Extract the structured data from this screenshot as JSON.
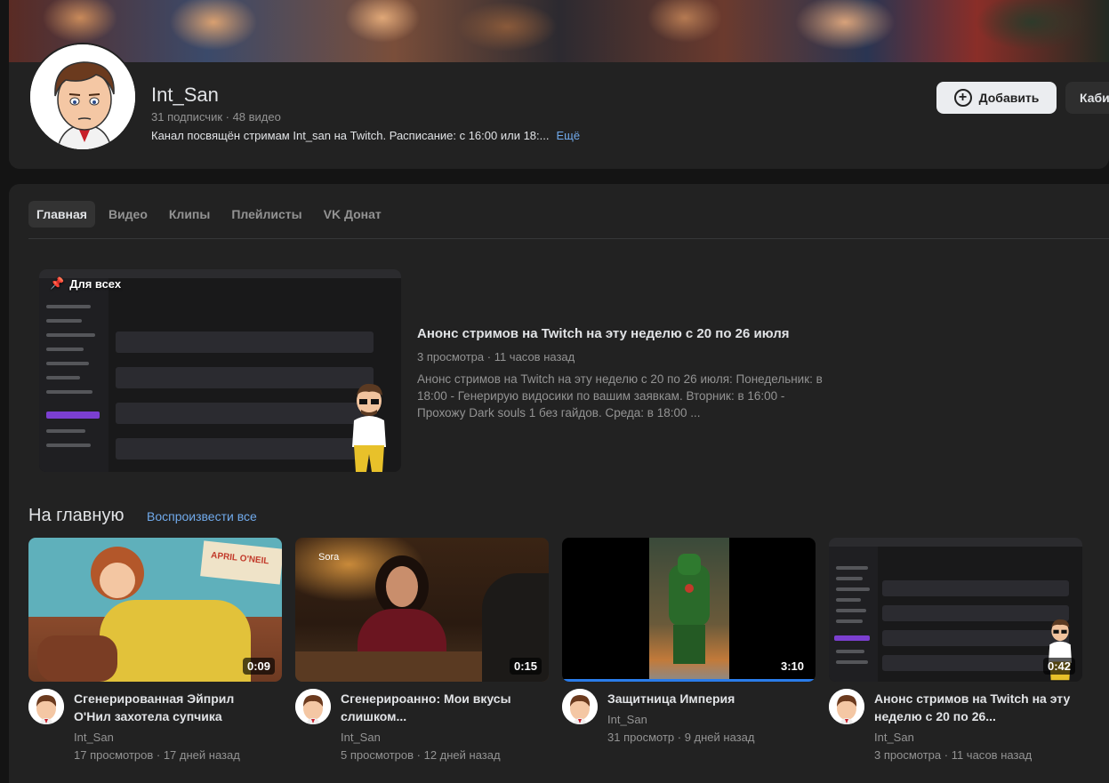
{
  "channel": {
    "name": "Int_San",
    "stats": "31 подписчик · 48 видео",
    "description": "Канал посвящён стримам Int_san на Twitch. Расписание: с 16:00 или 18:...",
    "more": "Ещё",
    "add_label": "Добавить",
    "cabinet_label": "Кабинет"
  },
  "tabs": [
    {
      "label": "Главная",
      "active": true
    },
    {
      "label": "Видео"
    },
    {
      "label": "Клипы"
    },
    {
      "label": "Плейлисты"
    },
    {
      "label": "VK Донат"
    }
  ],
  "featured": {
    "badge": "Для всех",
    "title": "Анонс стримов на Twitch на эту неделю с 20 по 26 июля",
    "meta": "3 просмотра · 11 часов назад",
    "description": "Анонс стримов на Twitch на эту неделю с 20 по 26 июля: Понедельник: в 18:00 - Генерирую видосики по вашим заявкам. Вторник: в 16:00 - Прохожу Dark souls 1 без гайдов. Среда: в 18:00 ..."
  },
  "section": {
    "title": "На главную",
    "play_all": "Воспроизвести все"
  },
  "videos": [
    {
      "title": "Сгенерированная Эйприл О'Нил захотела супчика",
      "author": "Int_San",
      "meta": "17 просмотров · 17 дней назад",
      "duration": "0:09"
    },
    {
      "title": "Сгенерироанно: Мои вкусы слишком...",
      "author": "Int_San",
      "meta": "5 просмотров · 12 дней назад",
      "duration": "0:15",
      "watermark": "Sora"
    },
    {
      "title": "Защитница Империя",
      "author": "Int_San",
      "meta": "31 просмотр · 9 дней назад",
      "duration": "3:10",
      "progress": 1.0
    },
    {
      "title": "Анонс стримов на Twitch на эту неделю с 20 по 26...",
      "author": "Int_San",
      "meta": "3 просмотра · 11 часов назад",
      "duration": "0:42"
    }
  ],
  "colors": {
    "accent": "#71aaeb",
    "progress": "#2a7cea"
  }
}
